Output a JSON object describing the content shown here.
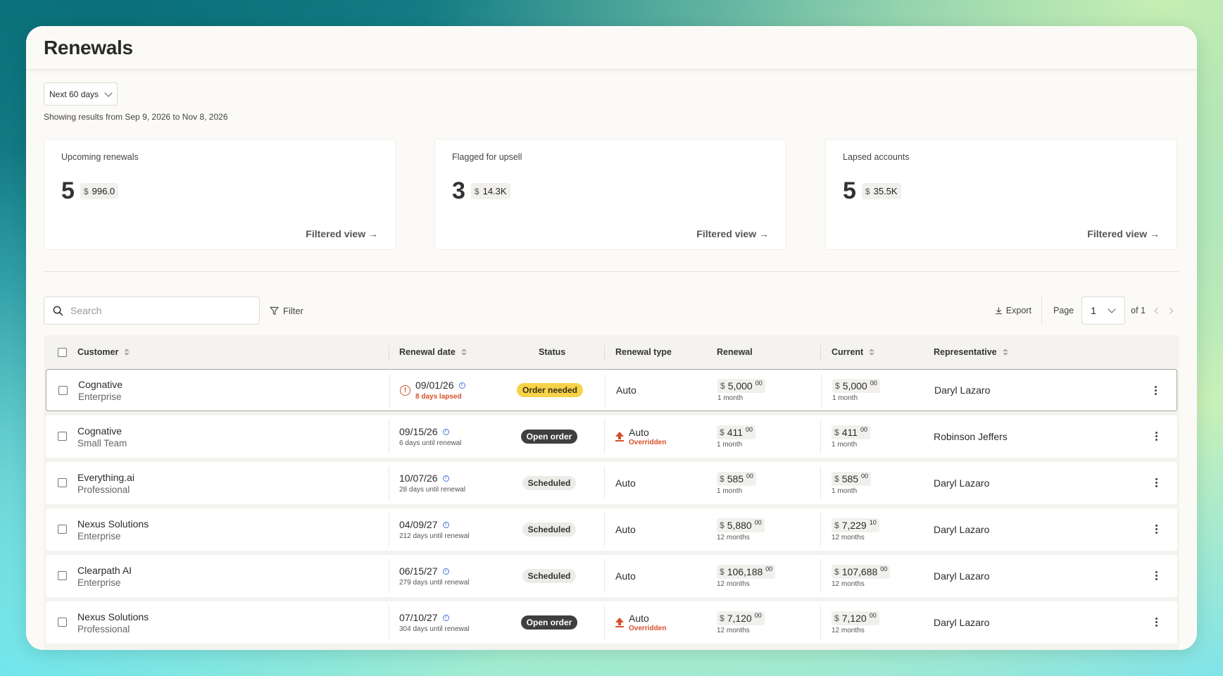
{
  "page": {
    "title": "Renewals"
  },
  "filters": {
    "range_value": "Next 60 days",
    "range_info": "Showing results from Sep 9, 2026 to Nov 8, 2026"
  },
  "cards": [
    {
      "title": "Upcoming renewals",
      "count": "5",
      "currency": "$",
      "amount": "996.0",
      "link": "Filtered view →"
    },
    {
      "title": "Flagged for upsell",
      "count": "3",
      "currency": "$",
      "amount": "14.3K",
      "link": "Filtered view →"
    },
    {
      "title": "Lapsed accounts",
      "count": "5",
      "currency": "$",
      "amount": "35.5K",
      "link": "Filtered view →"
    }
  ],
  "toolbar": {
    "search_placeholder": "Search",
    "filter_label": "Filter",
    "export_label": "Export",
    "page_label": "Page",
    "page_value": "1",
    "page_of": "of 1"
  },
  "table": {
    "columns": {
      "customer": "Customer",
      "renewal_date": "Renewal date",
      "status": "Status",
      "renewal_type": "Renewal type",
      "renewal": "Renewal",
      "current": "Current",
      "representative": "Representative"
    },
    "rows": [
      {
        "customer": "Cognative",
        "plan": "Enterprise",
        "date": "09/01/26",
        "date_sub": "8 days lapsed",
        "status": "Order needed",
        "type": "Auto",
        "override": "",
        "renewal_amt": "5,000",
        "renewal_cents": "00",
        "renewal_period": "1 month",
        "current_amt": "5,000",
        "current_cents": "00",
        "current_period": "1 month",
        "rep": "Daryl Lazaro"
      },
      {
        "customer": "Cognative",
        "plan": "Small Team",
        "date": "09/15/26",
        "date_sub": "6 days until renewal",
        "status": "Open order",
        "type": "Auto",
        "override": "Overridden",
        "renewal_amt": "411",
        "renewal_cents": "00",
        "renewal_period": "1 month",
        "current_amt": "411",
        "current_cents": "00",
        "current_period": "1 month",
        "rep": "Robinson Jeffers"
      },
      {
        "customer": "Everything.ai",
        "plan": "Professional",
        "date": "10/07/26",
        "date_sub": "28 days until renewal",
        "status": "Scheduled",
        "type": "Auto",
        "override": "",
        "renewal_amt": "585",
        "renewal_cents": "00",
        "renewal_period": "1 month",
        "current_amt": "585",
        "current_cents": "00",
        "current_period": "1 month",
        "rep": "Daryl Lazaro"
      },
      {
        "customer": "Nexus Solutions",
        "plan": "Enterprise",
        "date": "04/09/27",
        "date_sub": "212 days until renewal",
        "status": "Scheduled",
        "type": "Auto",
        "override": "",
        "renewal_amt": "5,880",
        "renewal_cents": "00",
        "renewal_period": "12 months",
        "current_amt": "7,229",
        "current_cents": "10",
        "current_period": "12 months",
        "rep": "Daryl Lazaro"
      },
      {
        "customer": "Clearpath AI",
        "plan": "Enterprise",
        "date": "06/15/27",
        "date_sub": "279 days until renewal",
        "status": "Scheduled",
        "type": "Auto",
        "override": "",
        "renewal_amt": "106,188",
        "renewal_cents": "00",
        "renewal_period": "12 months",
        "current_amt": "107,688",
        "current_cents": "00",
        "current_period": "12 months",
        "rep": "Daryl Lazaro"
      },
      {
        "customer": "Nexus Solutions",
        "plan": "Professional",
        "date": "07/10/27",
        "date_sub": "304 days until renewal",
        "status": "Open order",
        "type": "Auto",
        "override": "Overridden",
        "renewal_amt": "7,120",
        "renewal_cents": "00",
        "renewal_period": "12 months",
        "current_amt": "7,120",
        "current_cents": "00",
        "current_period": "12 months",
        "rep": "Daryl Lazaro"
      }
    ]
  },
  "currency": "$",
  "colors": {
    "accent_warning": "#d5502a",
    "status_order_needed": "#f7d34a",
    "status_open": "#3f3f3f"
  }
}
